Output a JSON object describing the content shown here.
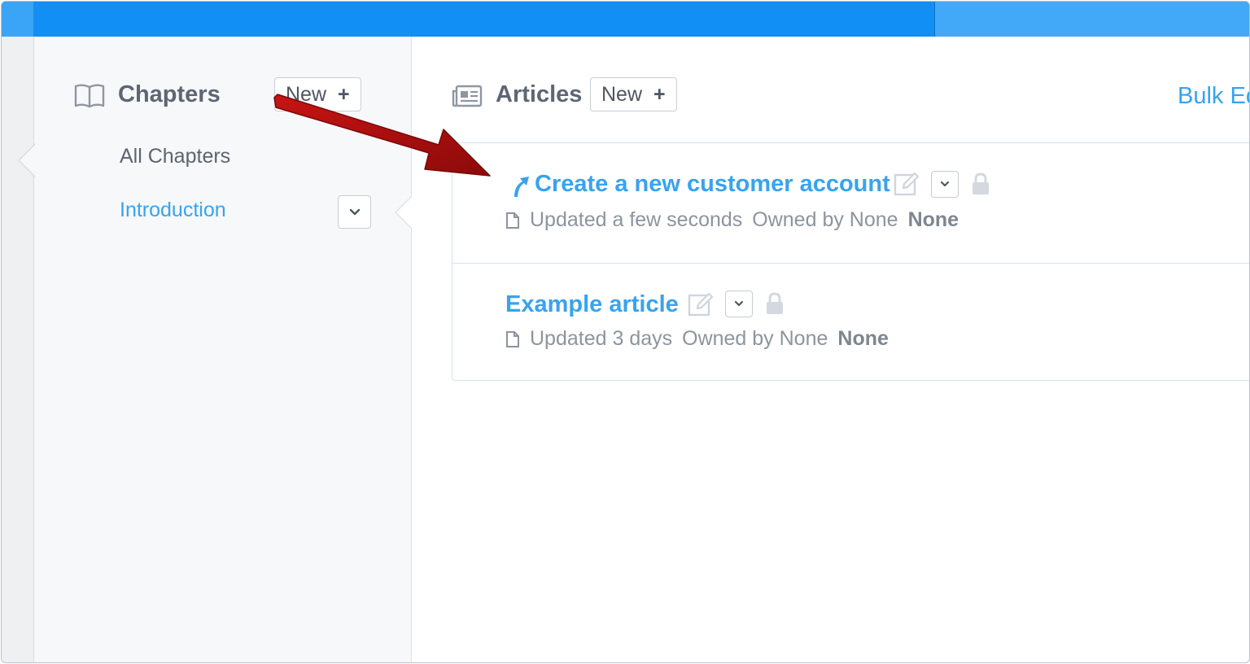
{
  "colors": {
    "topbar": "#118ff5",
    "link": "#37a3f0",
    "sidebar_bg": "#f7f8fa",
    "arrow": "#b20d0d"
  },
  "chapters": {
    "title": "Chapters",
    "icon": "book-icon",
    "new_label": "New",
    "new_plus": "+",
    "items": [
      {
        "label": "All Chapters",
        "active": false
      },
      {
        "label": "Introduction",
        "active": true,
        "dropdown_icon": "chevron-down-icon"
      }
    ]
  },
  "articles": {
    "title": "Articles",
    "icon": "newspaper-icon",
    "new_label": "New",
    "new_plus": "+",
    "bulk_edit_label": "Bulk Ed",
    "items": [
      {
        "title": "Create a new customer account",
        "leading_icon": "redirect-arrow-icon",
        "updated": "Updated a few seconds",
        "owned": "Owned by None",
        "status": "None",
        "icons": [
          "edit-icon",
          "chevron-down-icon",
          "lock-icon"
        ]
      },
      {
        "title": "Example article",
        "updated": "Updated 3 days",
        "owned": "Owned by None",
        "status": "None",
        "icons": [
          "edit-icon",
          "chevron-down-icon",
          "lock-icon"
        ]
      }
    ]
  }
}
